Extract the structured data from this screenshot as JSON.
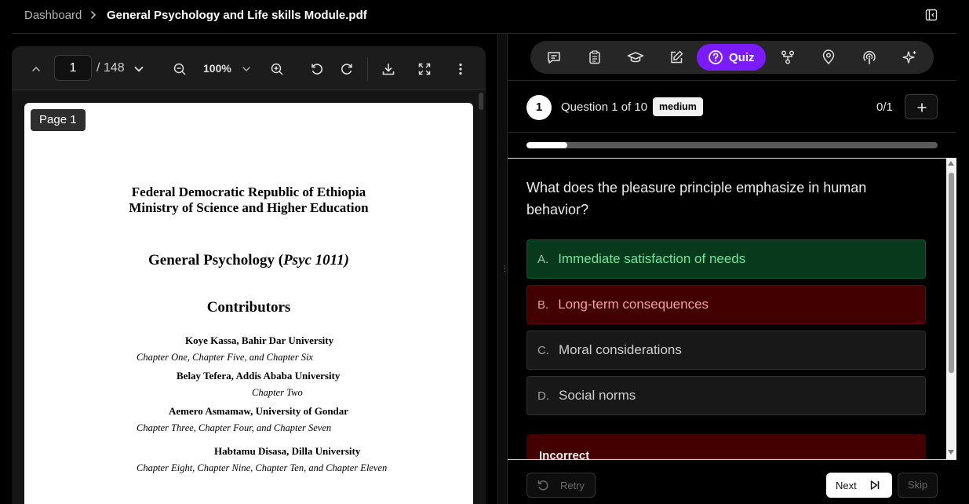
{
  "breadcrumb": {
    "root": "Dashboard",
    "current": "General Psychology and Life skills Module.pdf"
  },
  "pdf_viewer": {
    "page_current": "1",
    "page_total": "/ 148",
    "zoom": "100%",
    "page_badge": "Page 1",
    "icons": [
      "chevron-up-icon",
      "chevron-down-icon",
      "zoom-out-icon",
      "zoom-in-icon",
      "rotate-left-icon",
      "rotate-right-icon",
      "download-icon",
      "fullscreen-icon",
      "more-vertical-icon"
    ]
  },
  "document": {
    "line1": "Federal Democratic Republic of Ethiopia",
    "line2": "Ministry of Science and Higher Education",
    "course_title": "General Psychology (",
    "course_code": "Psyc 1011)",
    "contributors_heading": "Contributors",
    "contributors": [
      {
        "name": "Koye Kassa, Bahir Dar University",
        "chapters": "Chapter One, Chapter Five, and Chapter Six"
      },
      {
        "name": "Belay Tefera, Addis Ababa University",
        "chapters": "Chapter Two"
      },
      {
        "name": "Aemero Asmamaw, University of Gondar",
        "chapters": "Chapter Three, Chapter Four, and Chapter Seven"
      },
      {
        "name": "Habtamu Disasa, Dilla University",
        "chapters": "Chapter Eight, Chapter Nine, Chapter Ten, and Chapter Eleven"
      }
    ]
  },
  "tabs": {
    "items": [
      "chat-icon",
      "clipboard-icon",
      "graduation-cap-icon",
      "edit-icon",
      "quiz-icon",
      "mindmap-icon",
      "map-pin-icon",
      "podcast-icon",
      "sparkles-icon"
    ],
    "active_label": "Quiz",
    "active_color": "#7b1bff"
  },
  "quiz": {
    "number": "1",
    "label": "Question 1 of 10",
    "difficulty": "medium",
    "score": "0/1",
    "progress_fraction": 0.1,
    "question": "What does the pleasure principle emphasize in human behavior?",
    "options": [
      {
        "letter": "A.",
        "text": "Immediate satisfaction of needs",
        "state": "correct"
      },
      {
        "letter": "B.",
        "text": "Long-term consequences",
        "state": "wrong"
      },
      {
        "letter": "C.",
        "text": "Moral considerations",
        "state": "neutral"
      },
      {
        "letter": "D.",
        "text": "Social norms",
        "state": "neutral"
      }
    ],
    "feedback": "Incorrect",
    "retry_label": "Retry",
    "next_label": "Next",
    "skip_label": "Skip"
  }
}
